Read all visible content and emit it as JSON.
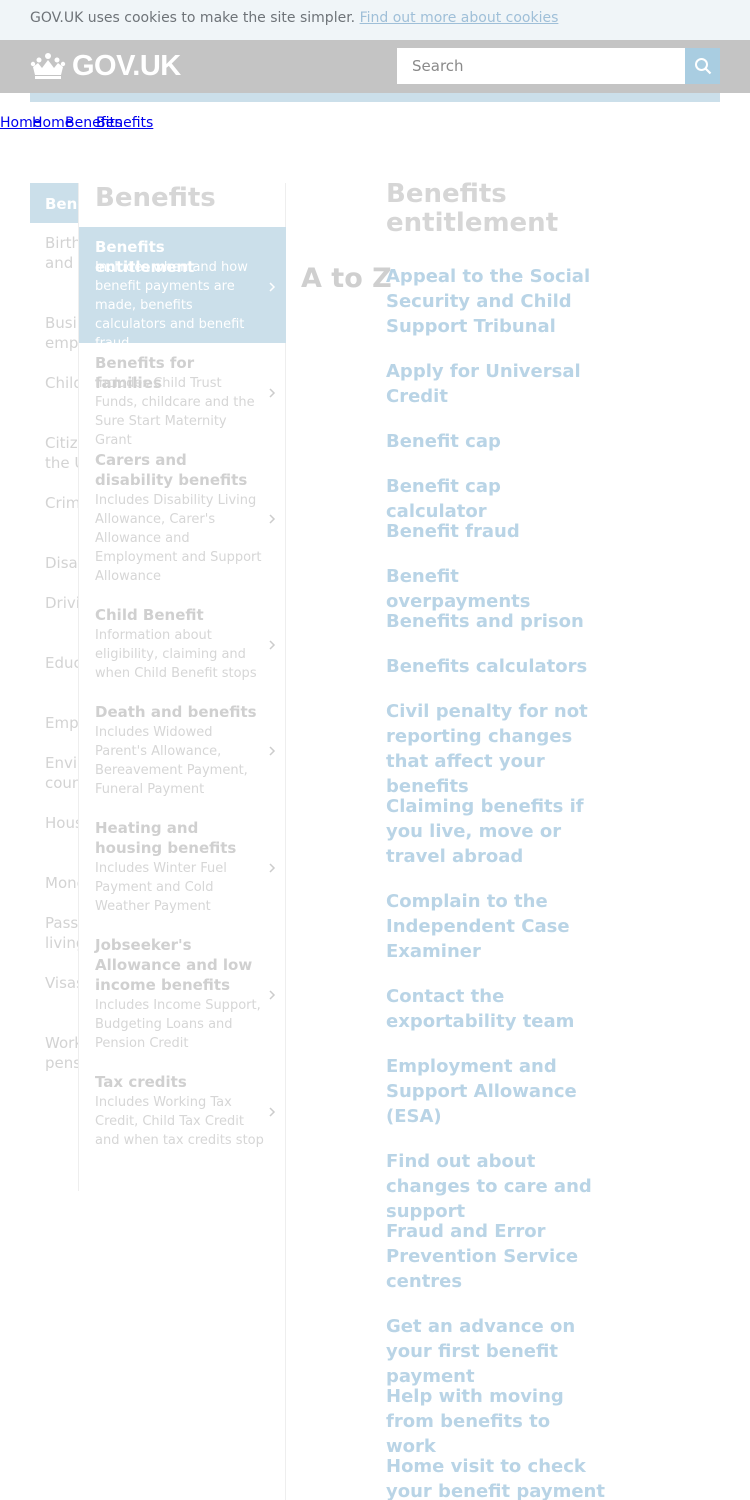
{
  "cookie_banner": {
    "text": "GOV.UK uses cookies to make the site simpler.",
    "link": "Find out more about cookies"
  },
  "header": {
    "logo_text": "GOV.UK",
    "search_placeholder": "Search"
  },
  "breadcrumb": [
    "Home",
    "Home",
    "Benefits",
    "Benefits"
  ],
  "sidebar": {
    "active_item": "Benefits",
    "items": [
      "Births, deaths, marriages and care",
      "Business and self-employed",
      "Childcare and parenting",
      "Citizenship and living in the UK",
      "Crime, justice and the law",
      "Disabled people",
      "Driving and transport",
      "Education and learning",
      "Employing people",
      "Environment and countryside",
      "Housing and local services",
      "Money and tax",
      "Passports, travel and living abroad",
      "Visas and immigration",
      "Working, jobs and pensions"
    ]
  },
  "subnav": {
    "title": "Benefits",
    "categories": [
      {
        "title": "Benefits entitlement",
        "description": "Includes when and how benefit payments are made, benefits calculators and benefit fraud",
        "active": true
      },
      {
        "title": "Benefits for families",
        "description": "Includes Child Trust Funds, childcare and the Sure Start Maternity Grant",
        "active": false
      },
      {
        "title": "Carers and disability benefits",
        "description": "Includes Disability Living Allowance, Carer's Allowance and Employment and Support Allowance",
        "active": false
      },
      {
        "title": "Child Benefit",
        "description": "Information about eligibility, claiming and when Child Benefit stops",
        "active": false
      },
      {
        "title": "Death and benefits",
        "description": "Includes Widowed Parent's Allowance, Bereavement Payment, Funeral Payment",
        "active": false
      },
      {
        "title": "Heating and housing benefits",
        "description": "Includes Winter Fuel Payment and Cold Weather Payment",
        "active": false
      },
      {
        "title": "Jobseeker's Allowance and low income benefits",
        "description": "Includes Income Support, Budgeting Loans and Pension Credit",
        "active": false
      },
      {
        "title": "Tax credits",
        "description": "Includes Working Tax Credit, Child Tax Credit and when tax credits stop",
        "active": false
      }
    ]
  },
  "content": {
    "az_label": "A to Z",
    "title": "Benefits entitlement",
    "links": [
      "Appeal to the Social Security and Child Support Tribunal",
      "Apply for Universal Credit",
      "Benefit cap",
      "Benefit cap calculator",
      "Benefit fraud",
      "Benefit overpayments",
      "Benefits and prison",
      "Benefits calculators",
      "Civil penalty for not reporting changes that affect your benefits",
      "Claiming benefits if you live, move or travel abroad",
      "Complain to the Independent Case Examiner",
      "Contact the exportability team",
      "Employment and Support Allowance (ESA)",
      "Find out about changes to care and support",
      "Fraud and Error Prevention Service centres",
      "Get an advance on your first benefit payment",
      "Help with moving from benefits to work",
      "Home visit to check your benefit payment"
    ]
  },
  "colors": {
    "header_bg": "#c4c4c4",
    "active_bg": "#cbdfea",
    "link": "#b9d4e6",
    "search_button": "#a9cde1"
  }
}
